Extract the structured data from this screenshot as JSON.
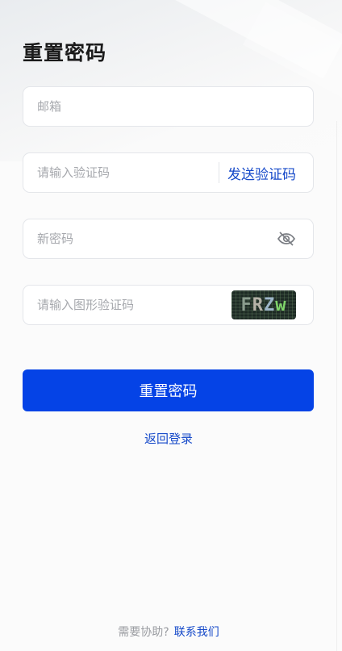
{
  "title": "重置密码",
  "fields": {
    "email": {
      "placeholder": "邮箱",
      "value": ""
    },
    "verify_code": {
      "placeholder": "请输入验证码",
      "value": "",
      "send_label": "发送验证码"
    },
    "new_password": {
      "placeholder": "新密码",
      "value": "",
      "icon": "eye-off-icon"
    },
    "captcha": {
      "placeholder": "请输入图形验证码",
      "value": "",
      "image_text": [
        "F",
        "R",
        "Z",
        "w"
      ]
    }
  },
  "submit_label": "重置密码",
  "back_label": "返回登录",
  "footer": {
    "help_text": "需要协助?",
    "contact_label": "联系我们"
  },
  "colors": {
    "primary": "#0543e6",
    "link": "#1549c9",
    "placeholder": "#a6a8ad"
  }
}
